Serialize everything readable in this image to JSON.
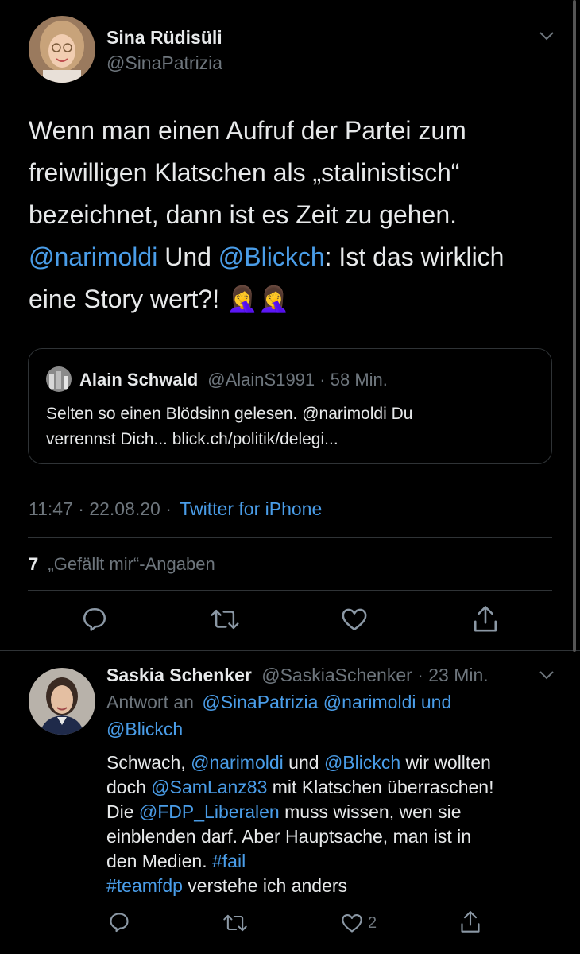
{
  "tweet": {
    "author_name": "Sina Rüdisüli",
    "author_handle": "@SinaPatrizia",
    "text_lines": [
      {
        "parts": [
          {
            "t": "Wenn man einen Aufruf der Partei zum",
            "link": false
          }
        ]
      },
      {
        "parts": [
          {
            "t": "freiwilligen Klatschen als „stalinistisch“",
            "link": false
          }
        ]
      },
      {
        "parts": [
          {
            "t": "bezeichnet, dann ist es Zeit zu gehen.",
            "link": false
          }
        ]
      },
      {
        "parts": [
          {
            "t": "@narimoldi",
            "link": true
          },
          {
            "t": " Und ",
            "link": false
          },
          {
            "t": "@Blickch",
            "link": true
          },
          {
            "t": ": Ist das wirklich",
            "link": false
          }
        ]
      },
      {
        "parts": [
          {
            "t": "eine Story wert?! 🤦‍♀️🤦‍♀️",
            "link": false
          }
        ]
      }
    ],
    "quote": {
      "name": "Alain Schwald",
      "handle": "@AlainS1991",
      "separator": "·",
      "time": "58 Min.",
      "line1": "Selten so einen Blödsinn gelesen. @narimoldi Du",
      "line2": "verrennst Dich... blick.ch/politik/delegi..."
    },
    "timestamp": "11:47 · 22.08.20 ·",
    "source": "Twitter for iPhone",
    "likes_count": "7",
    "likes_label": "„Gefällt mir“-Angaben"
  },
  "reply": {
    "name": "Saskia Schenker",
    "handle": "@SaskiaSchenker",
    "separator": "·",
    "time": "23 Min.",
    "reply_to_prefix": "Antwort an",
    "reply_to_1": "@SinaPatrizia @narimoldi und",
    "reply_to_2": "@Blickch",
    "text_lines": [
      {
        "parts": [
          {
            "t": "Schwach, ",
            "link": false
          },
          {
            "t": "@narimoldi",
            "link": true
          },
          {
            "t": " und ",
            "link": false
          },
          {
            "t": "@Blickch",
            "link": true
          },
          {
            "t": " wir wollten",
            "link": false
          }
        ]
      },
      {
        "parts": [
          {
            "t": "doch ",
            "link": false
          },
          {
            "t": "@SamLanz83",
            "link": true
          },
          {
            "t": " mit Klatschen überraschen!",
            "link": false
          }
        ]
      },
      {
        "parts": [
          {
            "t": "Die ",
            "link": false
          },
          {
            "t": "@FDP_Liberalen",
            "link": true
          },
          {
            "t": " muss wissen, wen sie",
            "link": false
          }
        ]
      },
      {
        "parts": [
          {
            "t": "einblenden darf. Aber Hauptsache, man ist in",
            "link": false
          }
        ]
      },
      {
        "parts": [
          {
            "t": "den Medien. ",
            "link": false
          },
          {
            "t": "#fail",
            "link": true
          }
        ]
      },
      {
        "parts": [
          {
            "t": "#teamfdp",
            "link": true
          },
          {
            "t": " verstehe ich anders",
            "link": false
          }
        ]
      }
    ],
    "like_count": "2"
  },
  "icons": {
    "reply": "reply-icon",
    "retweet": "retweet-icon",
    "like": "like-icon",
    "share": "share-icon",
    "more": "chevron-down-icon"
  },
  "colors": {
    "background": "#000000",
    "link": "#4a9de8",
    "muted": "#6e767d",
    "divider": "#2f3336"
  }
}
